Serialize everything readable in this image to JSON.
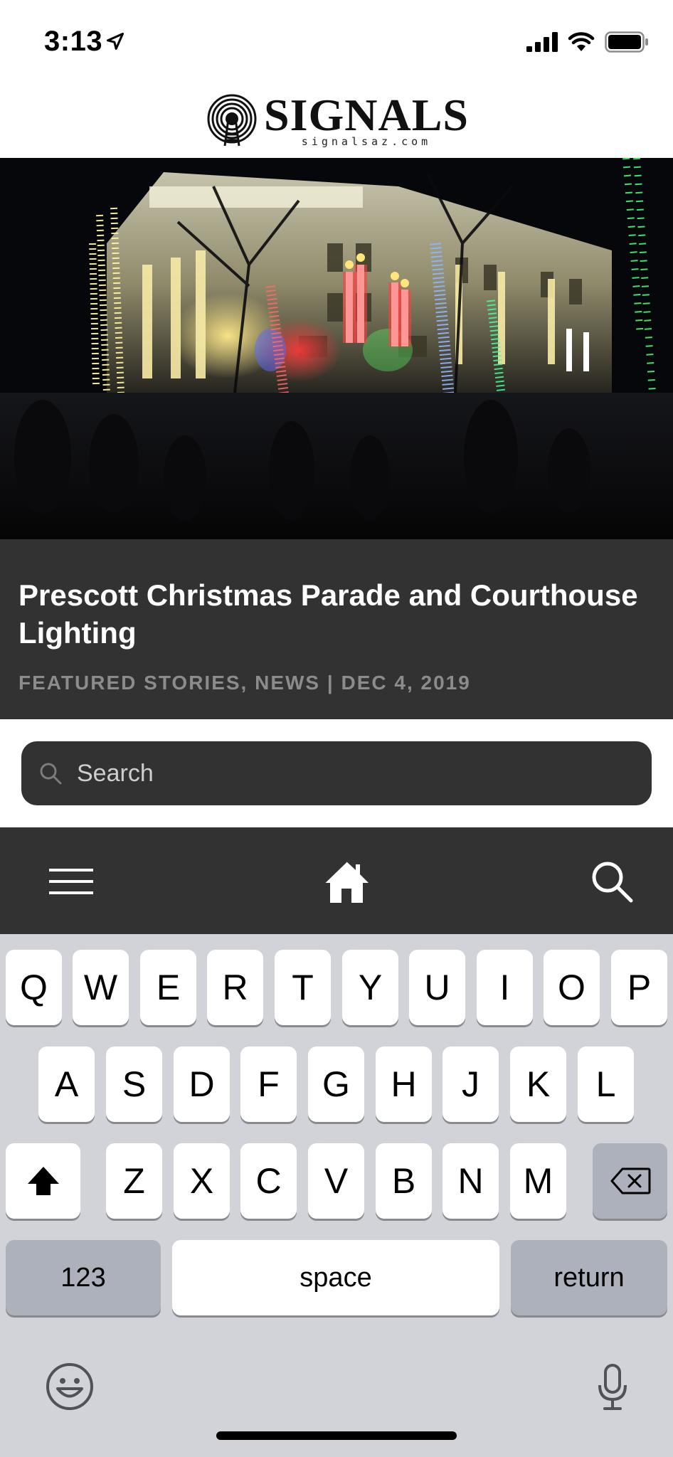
{
  "status_bar": {
    "time": "3:13",
    "icons": [
      "location-arrow-icon",
      "cellular-signal-icon",
      "wifi-icon",
      "battery-icon"
    ]
  },
  "header": {
    "logo_title": "SIGNALS",
    "logo_subtitle": "signalsaz.com",
    "logo_icon": "radio-tower-icon"
  },
  "featured": {
    "title": "Prescott Christmas Parade and Courthouse Lighting",
    "meta": "FEATURED STORIES, NEWS | DEC 4, 2019"
  },
  "search": {
    "placeholder": "Search",
    "value": ""
  },
  "bottom_nav": {
    "items": [
      "menu-icon",
      "home-icon",
      "search-icon"
    ]
  },
  "keyboard": {
    "row1": [
      "Q",
      "W",
      "E",
      "R",
      "T",
      "Y",
      "U",
      "I",
      "O",
      "P"
    ],
    "row2": [
      "A",
      "S",
      "D",
      "F",
      "G",
      "H",
      "J",
      "K",
      "L"
    ],
    "row3": [
      "Z",
      "X",
      "C",
      "V",
      "B",
      "N",
      "M"
    ],
    "numbers_label": "123",
    "space_label": "space",
    "return_label": "return",
    "icons": [
      "shift-icon",
      "backspace-icon",
      "emoji-icon",
      "microphone-icon"
    ]
  },
  "colors": {
    "caption_bg": "#323232",
    "keyboard_bg": "#d1d3d9",
    "meta_text": "#8c8c8c"
  }
}
